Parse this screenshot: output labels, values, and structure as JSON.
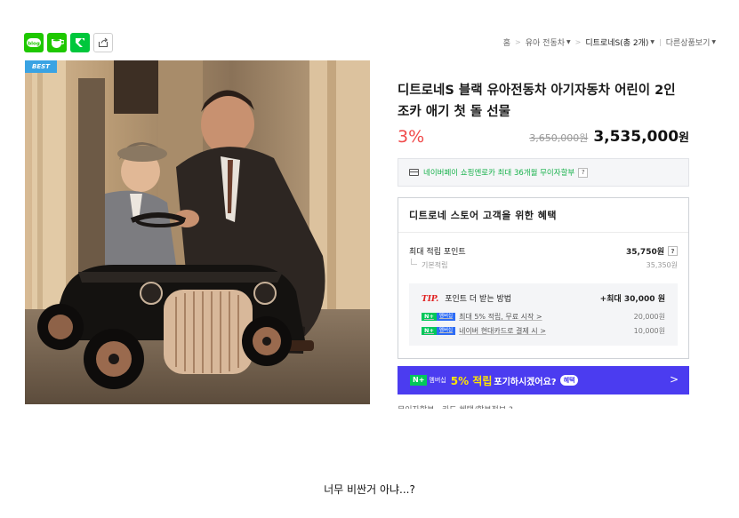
{
  "toolbar": {
    "share_icons": [
      {
        "name": "blog-icon",
        "label": "blog"
      },
      {
        "name": "cafe-icon",
        "label": ""
      },
      {
        "name": "kakao-icon",
        "label": ""
      },
      {
        "name": "share-icon",
        "label": ""
      }
    ],
    "breadcrumb": {
      "home": "홈",
      "category": "유아 전동차",
      "store": "디트로네S(총 2개)",
      "more": "다른상품보기"
    }
  },
  "product": {
    "badge": "BEST",
    "title": "디트로네S 블랙 유아전동차 아기자동차 어린이 2인 조카 애기 첫 돌 선물",
    "discount": "3%",
    "original_price": "3,650,000원",
    "sale_price": "3,535,000",
    "currency": "원"
  },
  "npay": {
    "text": "네이버페이 쇼핑엔로카 최대 36개월 무이자할부",
    "help": "?"
  },
  "benefit": {
    "title": "디트로네 스토어 고객을 위한 혜택",
    "max_points_label": "최대 적립 포인트",
    "max_points_value": "35,750원",
    "base_points_label": "기본적립",
    "base_points_value": "35,350원",
    "tip_label": "TIP.",
    "tip_text": "포인트 더 받는 방법",
    "tip_max": "+최대 30,000 원",
    "tip_rows": [
      {
        "badge_n": "N+",
        "badge_m": "멤버십",
        "text": "최대 5% 적립, 무료 시작 >",
        "amount": "20,000원"
      },
      {
        "badge_n": "N+",
        "badge_m": "멤버십",
        "text": "네이버 현대카드로 결제 시 >",
        "amount": "10,000원"
      }
    ]
  },
  "banner": {
    "badge_n": "N+",
    "badge_m": "멤버십",
    "highlight": "5% 적립",
    "text": "포기하시겠어요?",
    "pill": "혜택",
    "arrow": ">"
  },
  "cut_text": "무이자할부 · 카드 혜택/할부정보 ?",
  "caption": "너무 비싼거 아냐...?",
  "colors": {
    "discount": "#f04a4a",
    "naver_green": "#03c75a",
    "banner_bg": "#4b3cf0",
    "best_badge": "#3aa3e3"
  }
}
